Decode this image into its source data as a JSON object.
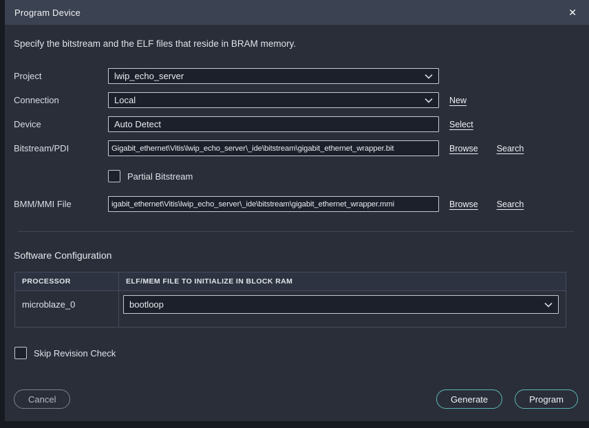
{
  "dialog": {
    "title": "Program Device",
    "close_icon": "✕",
    "description": "Specify the bitstream and the ELF files that reside in BRAM memory."
  },
  "fields": {
    "project": {
      "label": "Project",
      "value": "lwip_echo_server"
    },
    "connection": {
      "label": "Connection",
      "value": "Local",
      "action": "New"
    },
    "device": {
      "label": "Device",
      "value": "Auto Detect",
      "action": "Select"
    },
    "bitstream": {
      "label": "Bitstream/PDI",
      "value": "Gigabit_ethernet\\Vitis\\lwip_echo_server\\_ide\\bitstream\\gigabit_ethernet_wrapper.bit",
      "browse": "Browse",
      "search": "Search"
    },
    "partial_bitstream": {
      "label": "Partial Bitstream",
      "checked": false
    },
    "bmm": {
      "label": "BMM/MMI File",
      "value": "igabit_ethernet\\Vitis\\lwip_echo_server\\_ide\\bitstream\\gigabit_ethernet_wrapper.mmi",
      "browse": "Browse",
      "search": "Search"
    }
  },
  "software_configuration": {
    "title": "Software Configuration",
    "table": {
      "headers": [
        "PROCESSOR",
        "ELF/MEM FILE TO INITIALIZE IN BLOCK RAM"
      ],
      "rows": [
        {
          "processor": "microblaze_0",
          "elf_value": "bootloop"
        }
      ]
    }
  },
  "skip_revision": {
    "label": "Skip Revision Check",
    "checked": false
  },
  "footer": {
    "cancel": "Cancel",
    "generate": "Generate",
    "program": "Program",
    "accent_color": "#5cb8b4"
  }
}
